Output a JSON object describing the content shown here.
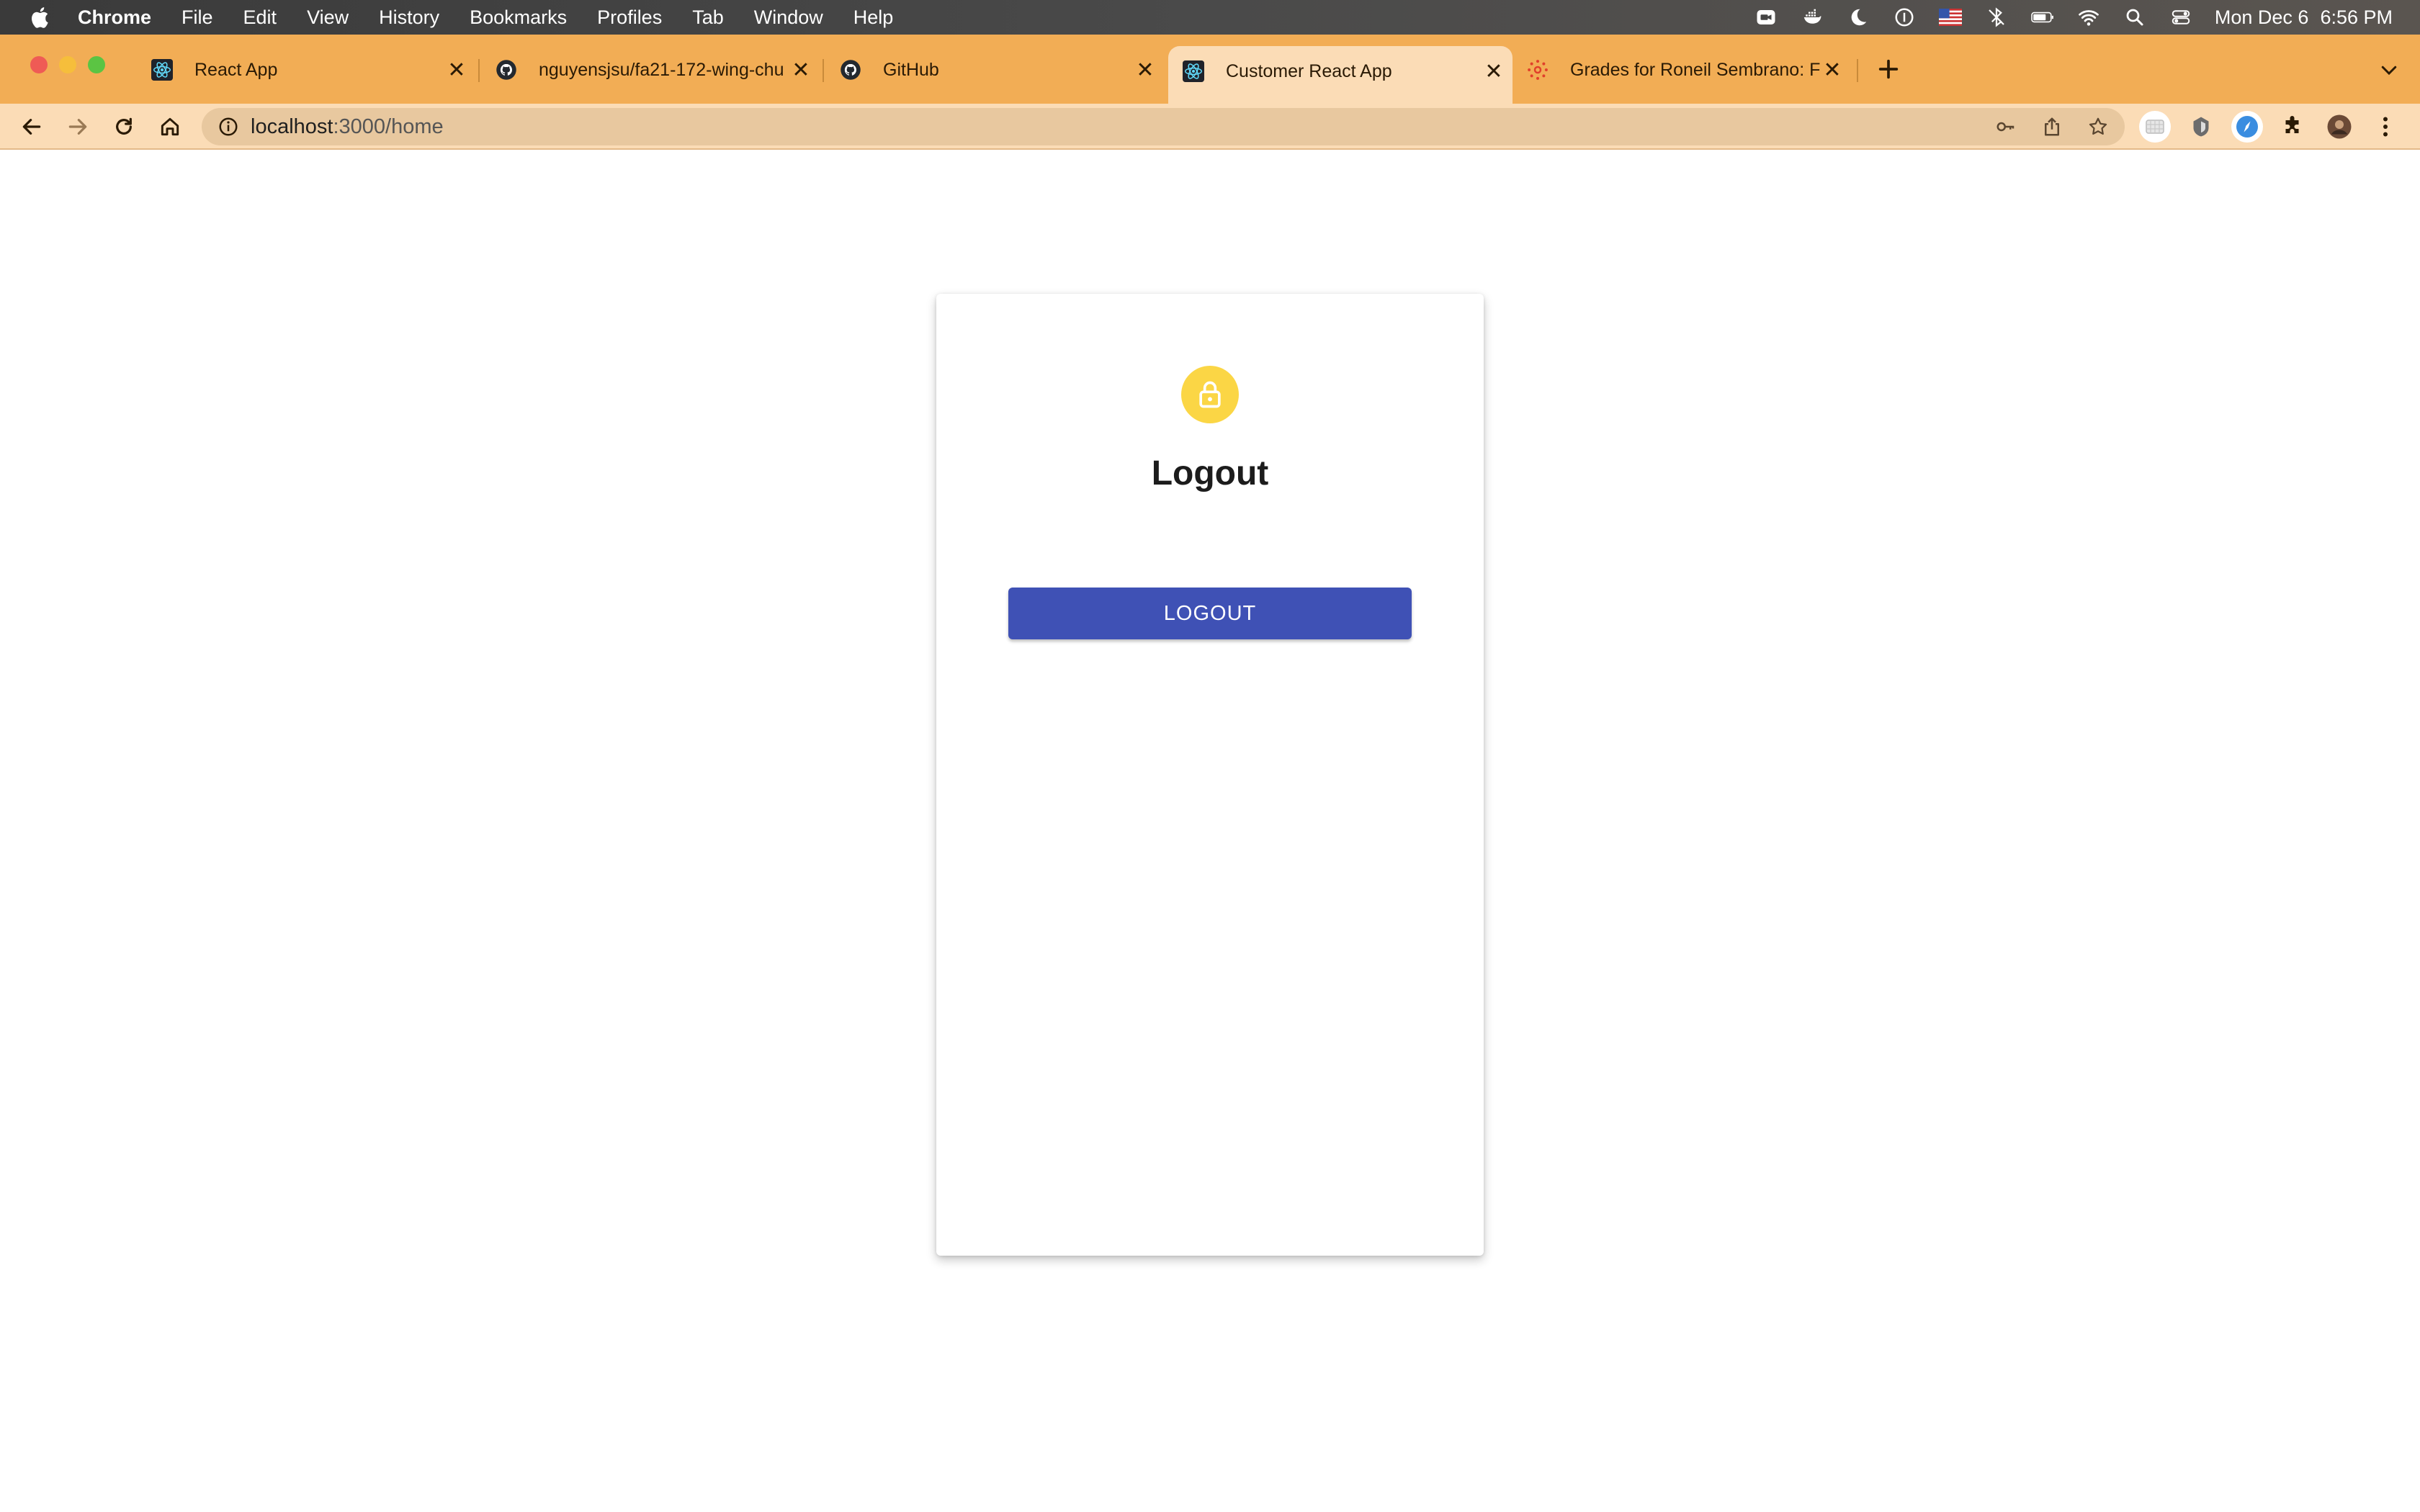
{
  "menubar": {
    "app_name": "Chrome",
    "items": [
      "File",
      "Edit",
      "View",
      "History",
      "Bookmarks",
      "Profiles",
      "Tab",
      "Window",
      "Help"
    ],
    "date": "Mon Dec 6",
    "time": "6:56 PM"
  },
  "tabs": [
    {
      "title": "React App",
      "icon": "react-icon",
      "active": false
    },
    {
      "title": "nguyensjsu/fa21-172-wing-chu",
      "icon": "github-icon",
      "active": false
    },
    {
      "title": "GitHub",
      "icon": "github-icon",
      "active": false
    },
    {
      "title": "Customer React App",
      "icon": "react-icon",
      "active": true
    },
    {
      "title": "Grades for Roneil Sembrano: F",
      "icon": "canvas-icon",
      "active": false
    }
  ],
  "address_bar": {
    "host": "localhost",
    "path": ":3000/home"
  },
  "page": {
    "title": "Logout",
    "button_label": "LOGOUT"
  },
  "colors": {
    "tab_strip": "#f2ad55",
    "toolbar": "#fbdcb6",
    "avatar": "#fbd645",
    "button": "#3f51b5"
  }
}
